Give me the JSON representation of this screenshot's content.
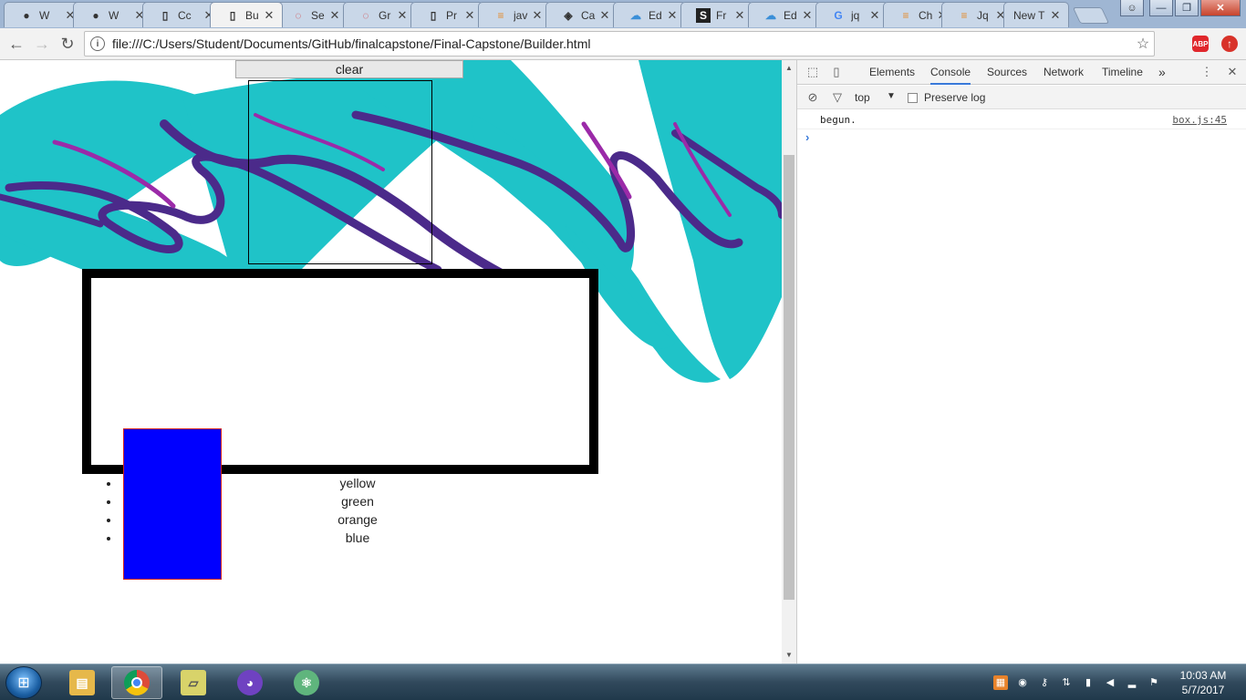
{
  "browser": {
    "tabs": [
      {
        "label": "W",
        "icon": "github-icon"
      },
      {
        "label": "W",
        "icon": "github-icon"
      },
      {
        "label": "Cc",
        "icon": "page-icon"
      },
      {
        "label": "Bu",
        "icon": "page-icon",
        "active": true
      },
      {
        "label": "Se",
        "icon": "spinner-icon"
      },
      {
        "label": "Gr",
        "icon": "spinner-icon"
      },
      {
        "label": "Pr",
        "icon": "page-icon"
      },
      {
        "label": "jav",
        "icon": "stackoverflow-icon"
      },
      {
        "label": "Ca",
        "icon": "codepen-icon"
      },
      {
        "label": "Ed",
        "icon": "cloud-icon"
      },
      {
        "label": "Fr",
        "icon": "s-icon"
      },
      {
        "label": "Ed",
        "icon": "cloud-icon"
      },
      {
        "label": "jq",
        "icon": "google-icon"
      },
      {
        "label": "Ch",
        "icon": "stackoverflow-icon"
      },
      {
        "label": "Jq",
        "icon": "stackoverflow-icon"
      },
      {
        "label": "New T",
        "icon": "none"
      }
    ],
    "tab_close_glyph": "✕",
    "url": "file:///C:/Users/Student/Documents/GitHub/finalcapstone/Final-Capstone/Builder.html",
    "extensions": [
      {
        "name": "adblock-plus-icon",
        "label": "ABP",
        "color": "#e0272c"
      },
      {
        "name": "upload-icon",
        "label": "↑",
        "color": "#d8322a"
      }
    ]
  },
  "page": {
    "clear_button": "clear",
    "list_items": [
      "yellow",
      "green",
      "orange",
      "blue"
    ],
    "colors": {
      "block": "#0000ff",
      "block_border": "#d02020",
      "teal": "#1fc3c8",
      "purple": "#4b2a8a",
      "magenta": "#9b2aa8"
    }
  },
  "devtools": {
    "tabs": [
      "Elements",
      "Console",
      "Sources",
      "Network",
      "Timeline"
    ],
    "active_tab": "Console",
    "more_glyph": "»",
    "context": "top",
    "preserve_log": "Preserve log",
    "console": [
      {
        "message": "begun.",
        "source": "box.js:45"
      }
    ],
    "prompt": "›"
  },
  "taskbar": {
    "time": "10:03 AM",
    "date": "5/7/2017",
    "apps": [
      {
        "name": "file-explorer-icon",
        "color": "#e6b84a"
      },
      {
        "name": "chrome-icon",
        "color": "#dd4b39",
        "active": true
      },
      {
        "name": "sticky-notes-icon",
        "color": "#d8d36a"
      },
      {
        "name": "github-desktop-icon",
        "color": "#6f42c1"
      },
      {
        "name": "atom-icon",
        "color": "#5fb57d"
      }
    ]
  }
}
